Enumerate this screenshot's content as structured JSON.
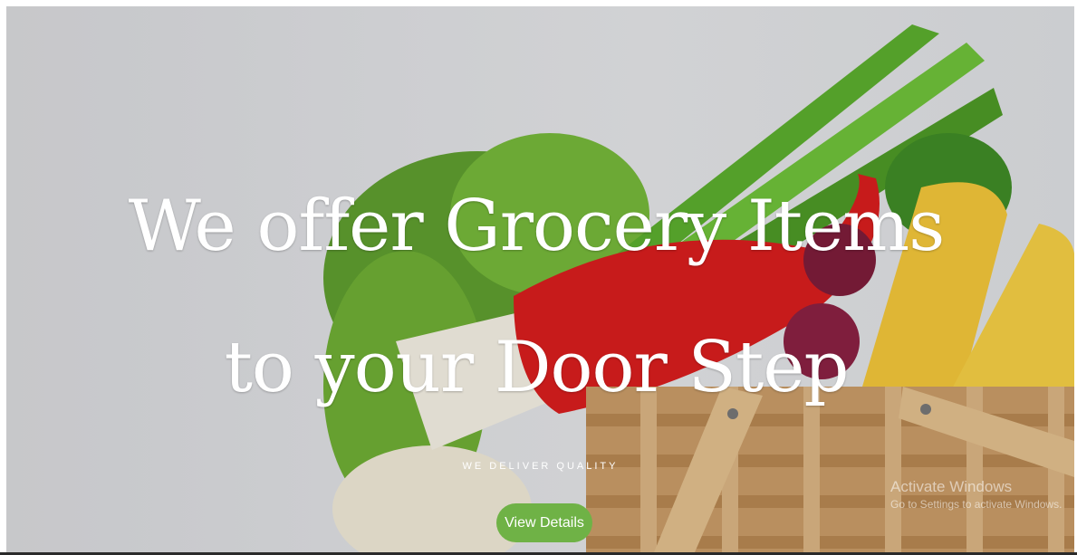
{
  "hero": {
    "headline": "We offer Grocery Items to your Door Step",
    "tagline": "WE DELIVER QUALITY",
    "cta_label": "View Details"
  },
  "os_watermark": {
    "title": "Activate Windows",
    "subtitle": "Go to Settings to activate Windows."
  },
  "colors": {
    "cta": "#6fb246",
    "text": "#ffffff",
    "background": "#dfe0e3"
  },
  "icons": [
    "vegetable-basket-image"
  ]
}
